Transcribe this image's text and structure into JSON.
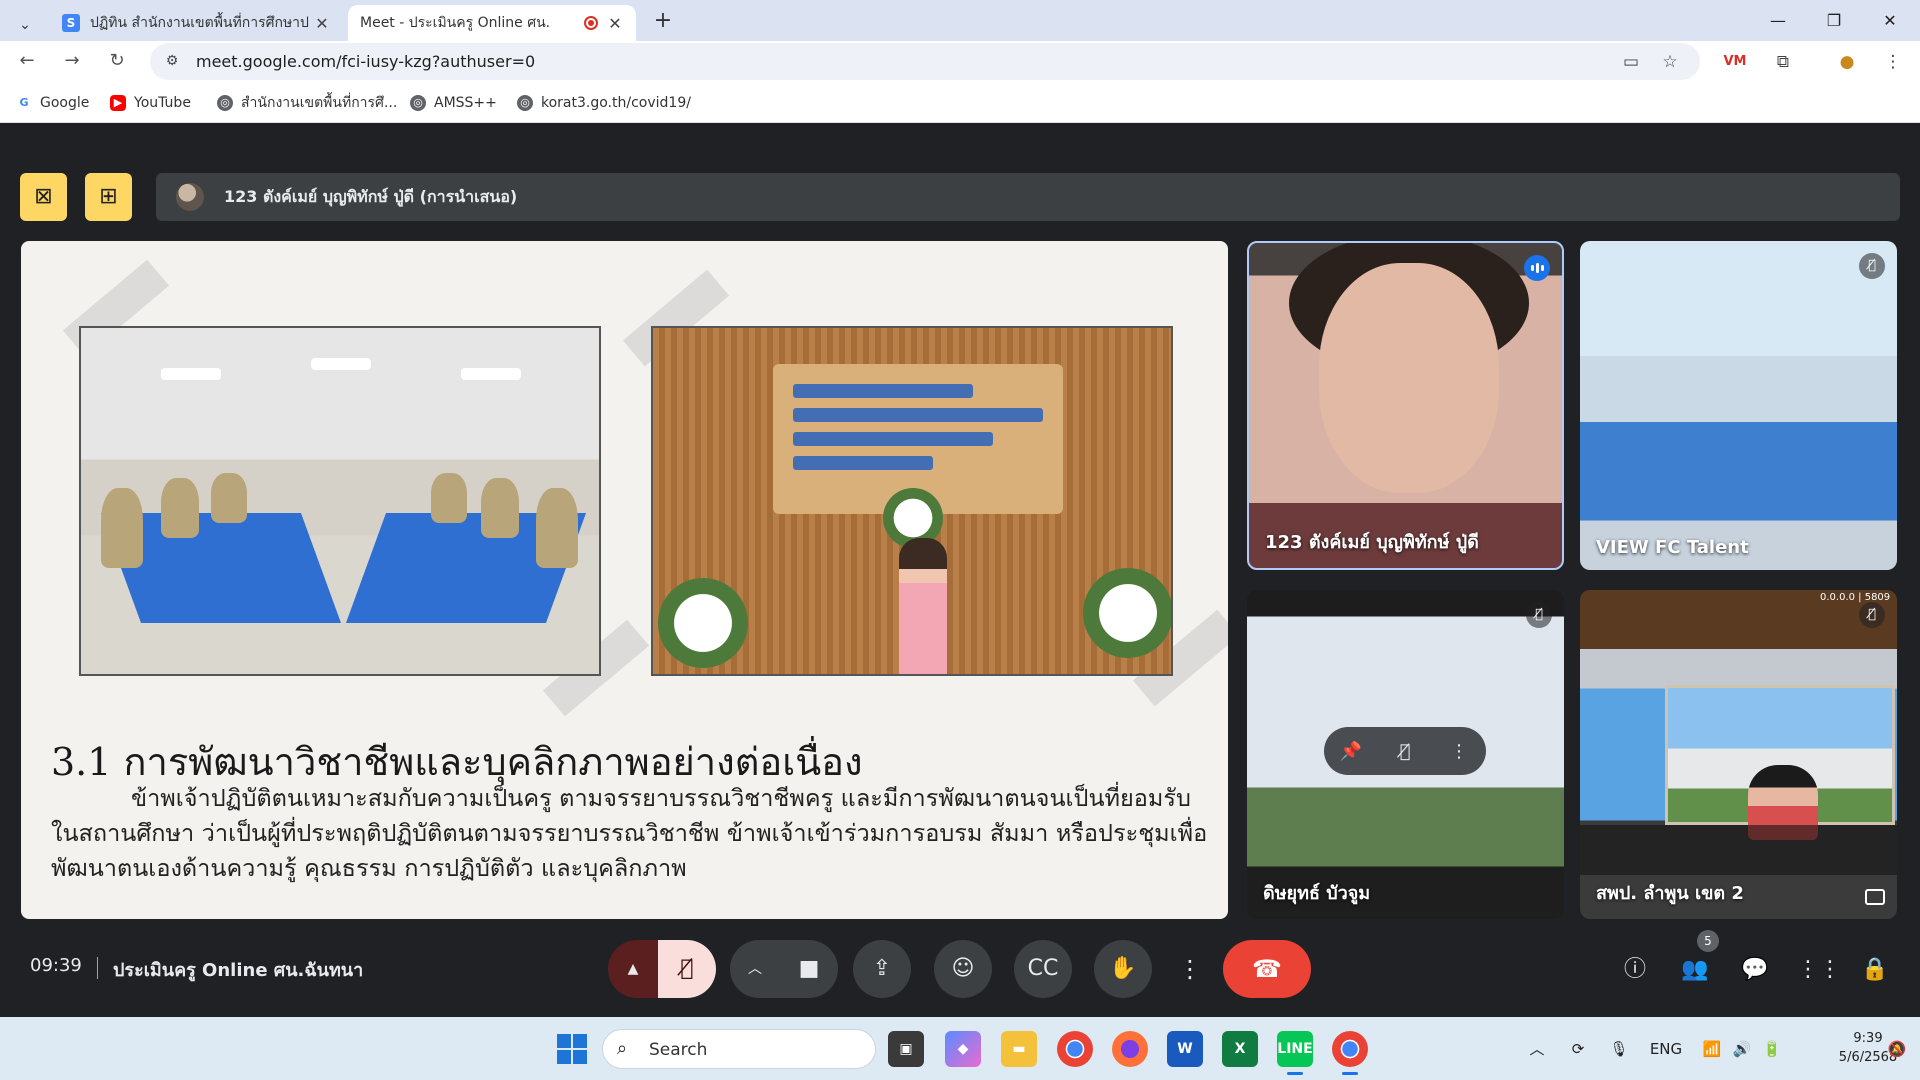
{
  "browser": {
    "tabs": [
      {
        "title": "ปฏิทิน สำนักงานเขตพื้นที่การศึกษาป",
        "icon": "google-sites-icon"
      },
      {
        "title": "Meet - ประเมินครู Online ศน.",
        "icon": "google-meet-icon",
        "recording": true,
        "active": true
      }
    ],
    "url": "meet.google.com/fci-iusy-kzg?authuser=0",
    "bookmarks": [
      {
        "label": "Google",
        "icon": "google-icon"
      },
      {
        "label": "YouTube",
        "icon": "youtube-icon"
      },
      {
        "label": "สำนักงานเขตพื้นที่การศึ...",
        "icon": "globe-icon"
      },
      {
        "label": "AMSS++",
        "icon": "globe-icon"
      },
      {
        "label": "korat3.go.th/covid19/",
        "icon": "globe-icon"
      }
    ]
  },
  "meet": {
    "presenter_label": "123 ตังค์เมย์ บุญพิทักษ์ ปู่ดี (การนำเสนอ)",
    "slide": {
      "title": "3.1  การพัฒนาวิชาชีพและบุคลิกภาพอย่างต่อเนื่อง",
      "body": "ข้าพเจ้าปฏิบัติตนเหมาะสมกับความเป็นครู ตามจรรยาบรรณวิชาชีพครู และมีการพัฒนาตนจนเป็นที่ยอมรับในสถานศึกษา ว่าเป็นผู้ที่ประพฤติปฏิบัติตนตามจรรยาบรรณวิชาชีพ ข้าพเจ้าเข้าร่วมการอบรม สัมมา หรือประชุมเพื่อพัฒนาตนเองด้านความรู้ คุณธรรม การปฏิบัติตัว และบุคลิกภาพ",
      "banner_text": [
        "อบรมเชิงปฏิบัติการ",
        "หลักสูตร BBL Summer Workshop",
        "อ่านออก เขียนได้ คิดวิเคราะห์เป็น",
        "วันที่ 24-25 เมษายน 2568"
      ]
    },
    "participants": [
      {
        "name": "123 ตังค์เมย์ บุญพิทักษ์ ปู่ดี",
        "speaking": true
      },
      {
        "name": "VIEW FC Talent",
        "muted": true
      },
      {
        "name": "ดิษยุทธ์ บัวจูม",
        "muted": true
      },
      {
        "name": "สพป. ลำพูน เขต 2",
        "muted": true,
        "overlay_text": "0.0.0.0 | 5809"
      }
    ],
    "time": "09:39",
    "meeting_name": "ประเมินครู Online ศน.ฉันทนา",
    "people_count": "5"
  },
  "taskbar": {
    "search_placeholder": "Search",
    "language": "ENG",
    "time": "9:39",
    "date": "5/6/2568"
  }
}
